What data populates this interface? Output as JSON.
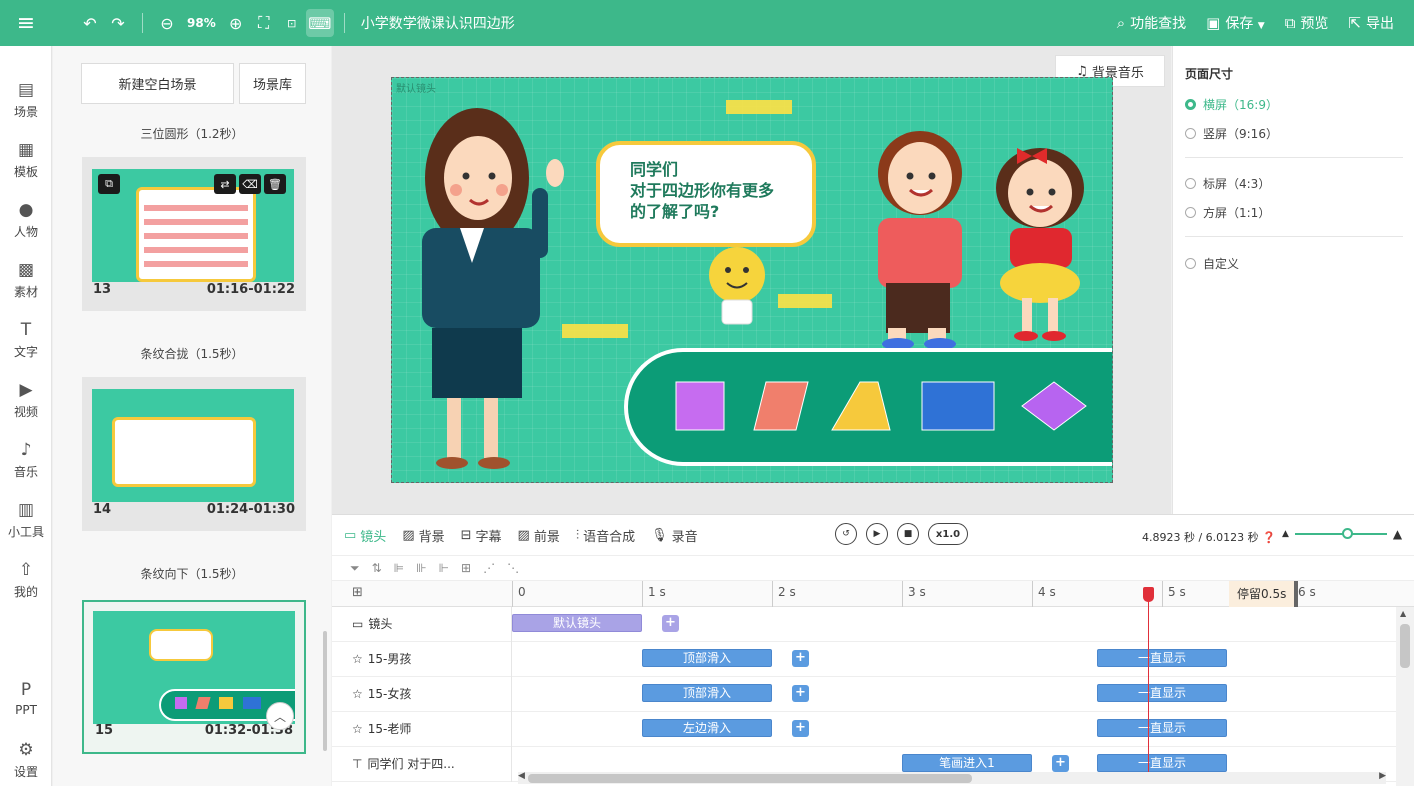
{
  "toolbar": {
    "zoom": "98%",
    "doc_title": "小学数学微课认识四边形",
    "feature_search": "功能查找",
    "save": "保存",
    "preview": "预览",
    "export": "导出"
  },
  "nav": {
    "items": [
      {
        "label": "场景"
      },
      {
        "label": "模板"
      },
      {
        "label": "人物"
      },
      {
        "label": "素材"
      },
      {
        "label": "文字"
      },
      {
        "label": "视频"
      },
      {
        "label": "音乐"
      },
      {
        "label": "小工具"
      },
      {
        "label": "我的"
      },
      {
        "label": "PPT"
      },
      {
        "label": "设置"
      }
    ]
  },
  "scenes": {
    "new_blank": "新建空白场景",
    "library": "场景库",
    "list": [
      {
        "transition": "三位圆形（1.2秒）",
        "num": "13",
        "time": "01:16-01:22"
      },
      {
        "transition": "条纹合拢（1.5秒）",
        "num": "14",
        "time": "01:24-01:30"
      },
      {
        "transition": "条纹向下（1.5秒）",
        "num": "15",
        "time": "01:32-01:38"
      }
    ]
  },
  "canvas": {
    "bgm": "背景音乐",
    "stage_label": "默认镜头",
    "bubble_line1": "同学们",
    "bubble_line2": "对于四边形你有更多",
    "bubble_line3": "的了解了吗?"
  },
  "props": {
    "title": "页面尺寸",
    "options": [
      {
        "label": "横屏（16:9）",
        "selected": true
      },
      {
        "label": "竖屏（9:16）",
        "selected": false
      },
      {
        "label": "标屏（4:3）",
        "selected": false
      },
      {
        "label": "方屏（1:1）",
        "selected": false
      },
      {
        "label": "自定义",
        "selected": false
      }
    ]
  },
  "timeline": {
    "tabs": [
      {
        "label": "镜头"
      },
      {
        "label": "背景"
      },
      {
        "label": "字幕"
      },
      {
        "label": "前景"
      },
      {
        "label": "语音合成"
      },
      {
        "label": "录音"
      }
    ],
    "speed": "x1.0",
    "time_readout": "4.8923 秒 / 6.0123 秒",
    "ruler": [
      "0",
      "1 s",
      "2 s",
      "3 s",
      "4 s",
      "5 s",
      "6 s"
    ],
    "stop_label": "停留0.5s",
    "playhead_seconds": 4.8923,
    "rows": [
      {
        "label": "镜头",
        "clips": [
          {
            "text": "默认镜头",
            "start": 0.0,
            "end": 1.0
          }
        ]
      },
      {
        "label": "15-男孩",
        "clips": [
          {
            "text": "顶部滑入",
            "start": 1.0,
            "end": 2.0
          },
          {
            "text": "一直显示",
            "start": 4.5,
            "end": 5.5
          }
        ]
      },
      {
        "label": "15-女孩",
        "clips": [
          {
            "text": "顶部滑入",
            "start": 1.0,
            "end": 2.0
          },
          {
            "text": "一直显示",
            "start": 4.5,
            "end": 5.5
          }
        ]
      },
      {
        "label": "15-老师",
        "clips": [
          {
            "text": "左边滑入",
            "start": 1.0,
            "end": 2.0
          },
          {
            "text": "一直显示",
            "start": 4.5,
            "end": 5.5
          }
        ]
      },
      {
        "label": "同学们 对于四...",
        "clips": [
          {
            "text": "笔画进入1",
            "start": 3.0,
            "end": 4.0
          },
          {
            "text": "一直显示",
            "start": 4.5,
            "end": 5.5
          }
        ]
      }
    ]
  }
}
